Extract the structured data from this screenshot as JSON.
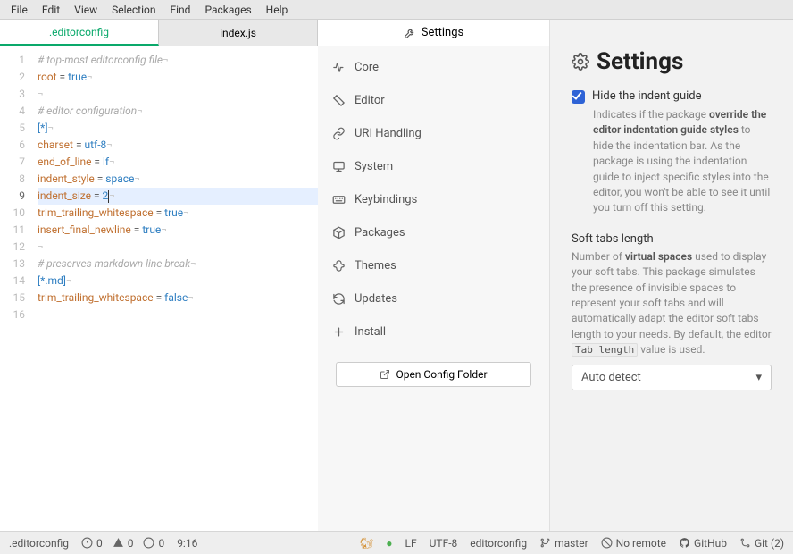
{
  "menubar": [
    "File",
    "Edit",
    "View",
    "Selection",
    "Find",
    "Packages",
    "Help"
  ],
  "tabs": {
    "active": ".editorconfig",
    "inactive": "index.js"
  },
  "code_lines": [
    {
      "t": "# top-most editorconfig file",
      "cls": "cm"
    },
    {
      "pre": "root",
      "op": " = ",
      "val": "true"
    },
    {
      "t": ""
    },
    {
      "t": "# editor configuration",
      "cls": "cm"
    },
    {
      "t": "[*]",
      "cls": "sec"
    },
    {
      "pre": "charset",
      "op": " = ",
      "val": "utf-8"
    },
    {
      "pre": "end_of_line",
      "op": " = ",
      "val": "lf"
    },
    {
      "pre": "indent_style",
      "op": " = ",
      "val": "space"
    },
    {
      "pre": "indent_size",
      "op": " = ",
      "val": "2",
      "cursor": true
    },
    {
      "pre": "trim_trailing_whitespace",
      "op": " = ",
      "val": "true"
    },
    {
      "pre": "insert_final_newline",
      "op": " = ",
      "val": "true"
    },
    {
      "t": ""
    },
    {
      "t": "# preserves markdown line break",
      "cls": "cm"
    },
    {
      "t": "[*.md]",
      "cls": "sec"
    },
    {
      "pre": "trim_trailing_whitespace",
      "op": " = ",
      "val": "false"
    },
    {
      "t": "",
      "noinvis": true
    }
  ],
  "settings_tab": "Settings",
  "nav": [
    {
      "label": "Core"
    },
    {
      "label": "Editor"
    },
    {
      "label": "URI Handling"
    },
    {
      "label": "System"
    },
    {
      "label": "Keybindings"
    },
    {
      "label": "Packages"
    },
    {
      "label": "Themes"
    },
    {
      "label": "Updates"
    },
    {
      "label": "Install"
    }
  ],
  "open_config": "Open Config Folder",
  "settings_title": "Settings",
  "hide_label": "Hide the indent guide",
  "hide_desc_pre": "Indicates if the package ",
  "hide_desc_bold": "override the editor indentation guide styles",
  "hide_desc_post": " to hide the indentation bar. As the package is using the indentation guide to inject specific styles into the editor, you won't be able to see it until you turn off this setting.",
  "soft_label": "Soft tabs length",
  "soft_desc_pre": "Number of ",
  "soft_desc_bold": "virtual spaces",
  "soft_desc_mid": " used to display your soft tabs. This package simulates the presence of invisible spaces to represent your soft tabs and will automatically adapt the editor soft tabs length to your needs. By default, the editor ",
  "soft_code": "Tab length",
  "soft_desc_post": " value is used.",
  "select_value": "Auto detect",
  "status": {
    "filename": ".editorconfig",
    "diag": "0",
    "warn": "0",
    "info": "0",
    "cursor": "9:16",
    "line_ending": "LF",
    "encoding": "UTF-8",
    "grammar": "editorconfig",
    "branch": "master",
    "remote": "No remote",
    "github": "GitHub",
    "git": "Git (2)"
  }
}
